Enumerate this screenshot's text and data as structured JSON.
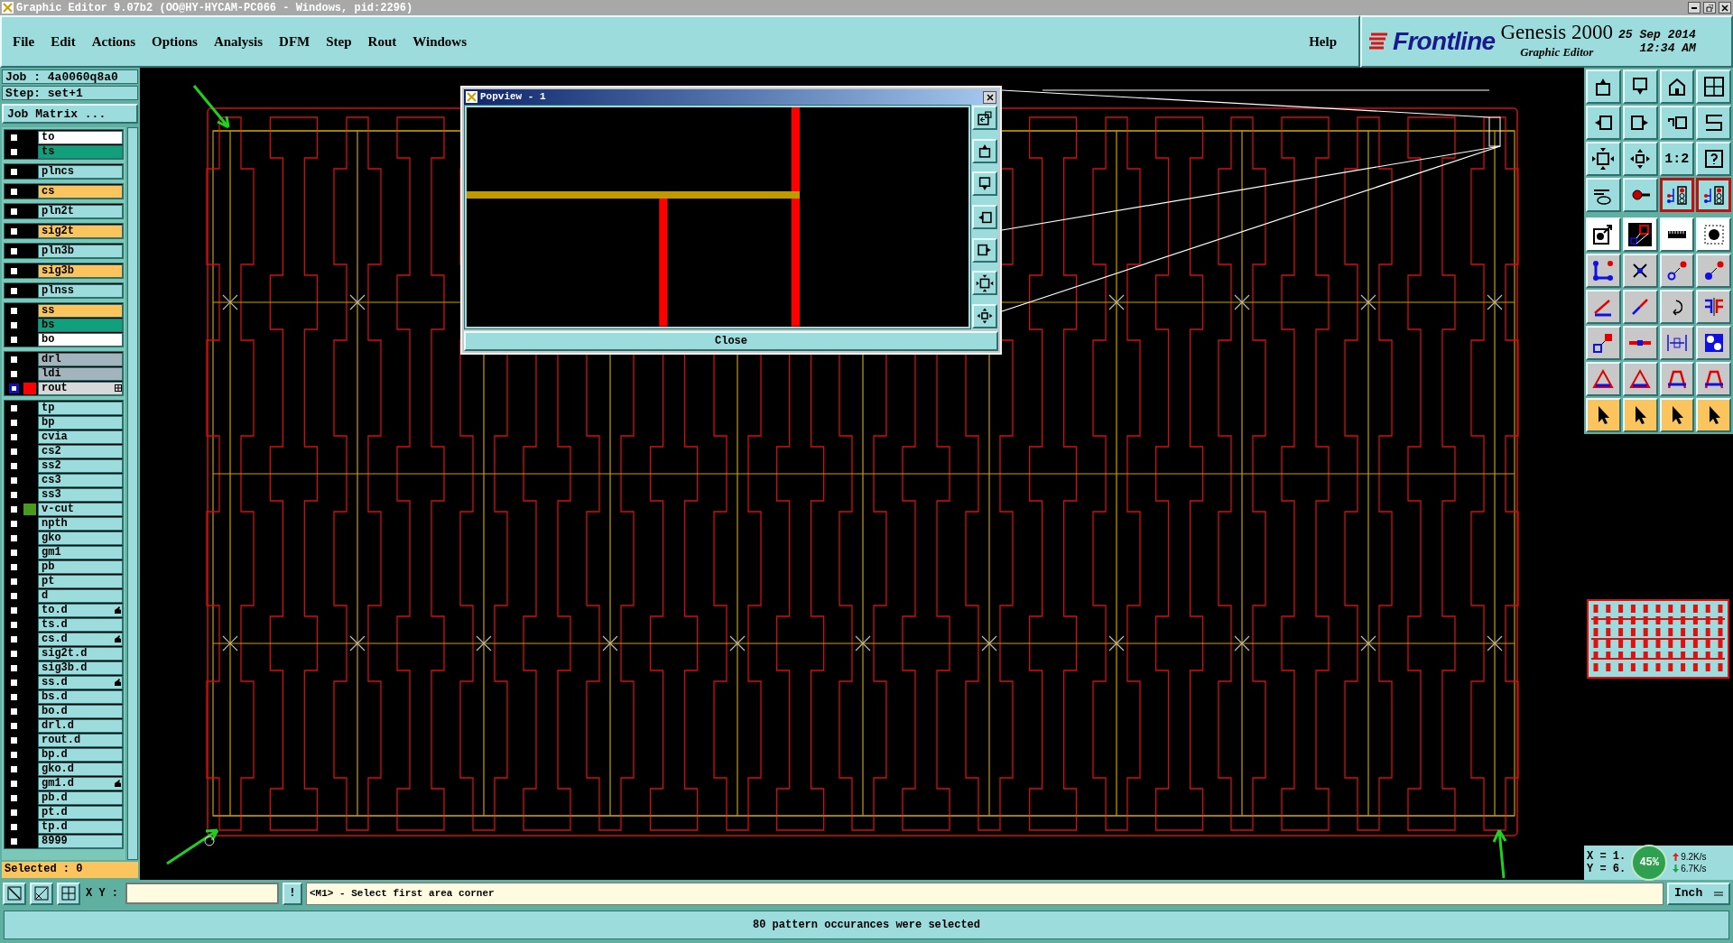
{
  "window": {
    "title": "Graphic Editor 9.07b2 (OO@HY-HYCAM-PC066 - Windows, pid:2296)"
  },
  "menu": [
    "File",
    "Edit",
    "Actions",
    "Options",
    "Analysis",
    "DFM",
    "Step",
    "Rout",
    "Windows"
  ],
  "help": "Help",
  "brand": {
    "logo": "Frontline",
    "product": "Genesis 2000",
    "subtitle": "Graphic Editor",
    "date": "25 Sep 2014",
    "time": "12:34 AM"
  },
  "job": {
    "job": "Job : 4a0060q8a0",
    "step": "Step: set+1",
    "matrix_button": "Job Matrix ..."
  },
  "layer_groups": [
    [
      {
        "name": "to",
        "kind": "silk",
        "affected": false,
        "work_mark": false,
        "linked": false
      },
      {
        "name": "ts",
        "kind": "mask",
        "affected": false,
        "work_mark": false,
        "linked": false
      }
    ],
    [
      {
        "name": "plncs",
        "kind": "power",
        "affected": false,
        "work_mark": false,
        "linked": false
      }
    ],
    [
      {
        "name": "cs",
        "kind": "signal",
        "affected": false,
        "work_mark": false,
        "linked": false
      }
    ],
    [
      {
        "name": "pln2t",
        "kind": "power",
        "affected": false,
        "work_mark": false,
        "linked": false
      }
    ],
    [
      {
        "name": "sig2t",
        "kind": "signal",
        "affected": false,
        "work_mark": false,
        "linked": false
      }
    ],
    [
      {
        "name": "pln3b",
        "kind": "power",
        "affected": false,
        "work_mark": false,
        "linked": false
      }
    ],
    [
      {
        "name": "sig3b",
        "kind": "signal",
        "affected": false,
        "work_mark": false,
        "linked": false
      }
    ],
    [
      {
        "name": "plnss",
        "kind": "power",
        "affected": false,
        "work_mark": false,
        "linked": false
      }
    ],
    [
      {
        "name": "ss",
        "kind": "signal",
        "affected": false,
        "work_mark": false,
        "linked": false
      },
      {
        "name": "bs",
        "kind": "mask",
        "affected": false,
        "work_mark": false,
        "linked": false
      },
      {
        "name": "bo",
        "kind": "silk",
        "affected": false,
        "work_mark": false,
        "linked": false
      }
    ],
    [
      {
        "name": "drl",
        "kind": "drill",
        "affected": false,
        "work_mark": false,
        "linked": false
      },
      {
        "name": "ldi",
        "kind": "drill",
        "affected": false,
        "work_mark": false,
        "linked": false
      },
      {
        "name": "rout",
        "kind": "rout",
        "affected": true,
        "work_mark": false,
        "linked": true,
        "color": "#ff0000"
      }
    ],
    [
      {
        "name": "tp",
        "kind": "misc",
        "affected": false,
        "work_mark": false,
        "linked": false
      },
      {
        "name": "bp",
        "kind": "misc",
        "affected": false,
        "work_mark": false,
        "linked": false
      },
      {
        "name": "cvia",
        "kind": "misc",
        "affected": false,
        "work_mark": false,
        "linked": false
      },
      {
        "name": "cs2",
        "kind": "misc",
        "affected": false,
        "work_mark": false,
        "linked": false
      },
      {
        "name": "ss2",
        "kind": "misc",
        "affected": false,
        "work_mark": false,
        "linked": false
      },
      {
        "name": "cs3",
        "kind": "misc",
        "affected": false,
        "work_mark": false,
        "linked": false
      },
      {
        "name": "ss3",
        "kind": "misc",
        "affected": false,
        "work_mark": false,
        "linked": false
      },
      {
        "name": "v-cut",
        "kind": "misc",
        "affected": false,
        "work_mark": false,
        "linked": false,
        "color": "#4a9a20"
      },
      {
        "name": "npth",
        "kind": "misc",
        "affected": false,
        "work_mark": false,
        "linked": false
      },
      {
        "name": "gko",
        "kind": "misc",
        "affected": false,
        "work_mark": false,
        "linked": false
      },
      {
        "name": "gm1",
        "kind": "misc",
        "affected": false,
        "work_mark": false,
        "linked": false
      },
      {
        "name": "pb",
        "kind": "misc",
        "affected": false,
        "work_mark": false,
        "linked": false
      },
      {
        "name": "pt",
        "kind": "misc",
        "affected": false,
        "work_mark": false,
        "linked": false
      },
      {
        "name": "d",
        "kind": "misc",
        "affected": false,
        "work_mark": false,
        "linked": false
      },
      {
        "name": "to.d",
        "kind": "misc",
        "affected": false,
        "work_mark": true,
        "linked": false
      },
      {
        "name": "ts.d",
        "kind": "misc",
        "affected": false,
        "work_mark": false,
        "linked": false
      },
      {
        "name": "cs.d",
        "kind": "misc",
        "affected": false,
        "work_mark": true,
        "linked": false
      },
      {
        "name": "sig2t.d",
        "kind": "misc",
        "affected": false,
        "work_mark": false,
        "linked": false
      },
      {
        "name": "sig3b.d",
        "kind": "misc",
        "affected": false,
        "work_mark": false,
        "linked": false
      },
      {
        "name": "ss.d",
        "kind": "misc",
        "affected": false,
        "work_mark": true,
        "linked": false
      },
      {
        "name": "bs.d",
        "kind": "misc",
        "affected": false,
        "work_mark": false,
        "linked": false
      },
      {
        "name": "bo.d",
        "kind": "misc",
        "affected": false,
        "work_mark": false,
        "linked": false
      },
      {
        "name": "drl.d",
        "kind": "misc",
        "affected": false,
        "work_mark": false,
        "linked": false
      },
      {
        "name": "rout.d",
        "kind": "misc",
        "affected": false,
        "work_mark": false,
        "linked": false
      },
      {
        "name": "bp.d",
        "kind": "misc",
        "affected": false,
        "work_mark": false,
        "linked": false
      },
      {
        "name": "gko.d",
        "kind": "misc",
        "affected": false,
        "work_mark": false,
        "linked": false
      },
      {
        "name": "gm1.d",
        "kind": "misc",
        "affected": false,
        "work_mark": true,
        "linked": false
      },
      {
        "name": "pb.d",
        "kind": "misc",
        "affected": false,
        "work_mark": false,
        "linked": false
      },
      {
        "name": "pt.d",
        "kind": "misc",
        "affected": false,
        "work_mark": false,
        "linked": false
      },
      {
        "name": "tp.d",
        "kind": "misc",
        "affected": false,
        "work_mark": false,
        "linked": false
      },
      {
        "name": "8999",
        "kind": "misc",
        "affected": false,
        "work_mark": false,
        "linked": false
      }
    ]
  ],
  "selected_count": "Selected : 0",
  "popview": {
    "title": "Popview - 1",
    "close": "Close"
  },
  "tools": [
    {
      "active": false
    },
    {
      "active": false
    },
    {
      "active": false
    },
    {
      "active": false
    },
    {
      "active": false
    },
    {
      "active": false
    },
    {
      "active": false
    },
    {
      "active": false
    },
    {
      "active": false
    },
    {
      "active": false
    },
    {
      "active": false
    },
    {
      "active": false
    },
    {
      "active": false
    },
    {
      "active": false
    },
    {
      "active": true
    },
    {
      "active": true
    },
    {
      "active": false
    },
    {
      "active": false
    },
    {
      "active": false
    },
    {
      "active": false
    },
    {
      "active": false
    },
    {
      "active": false
    },
    {
      "active": false
    },
    {
      "active": false
    },
    {
      "active": false
    },
    {
      "active": false
    },
    {
      "active": false
    },
    {
      "active": false
    },
    {
      "active": false
    },
    {
      "active": false
    },
    {
      "active": false
    },
    {
      "active": false
    },
    {
      "active": false
    },
    {
      "active": false
    },
    {
      "active": false
    },
    {
      "active": false
    },
    {
      "active": false
    },
    {
      "active": false
    },
    {
      "active": false
    },
    {
      "active": false
    }
  ],
  "scale_label": "1:2",
  "coords": {
    "x": "X = 1.",
    "y": "Y = 6."
  },
  "network": {
    "percent": "45%",
    "up": "9.2K/s",
    "down": "6.7K/s"
  },
  "command": {
    "xy_label": "X Y :",
    "bang": "!",
    "prompt": "<M1> - Select first area corner",
    "units": "Inch"
  },
  "status": "80 pattern occurances were selected"
}
